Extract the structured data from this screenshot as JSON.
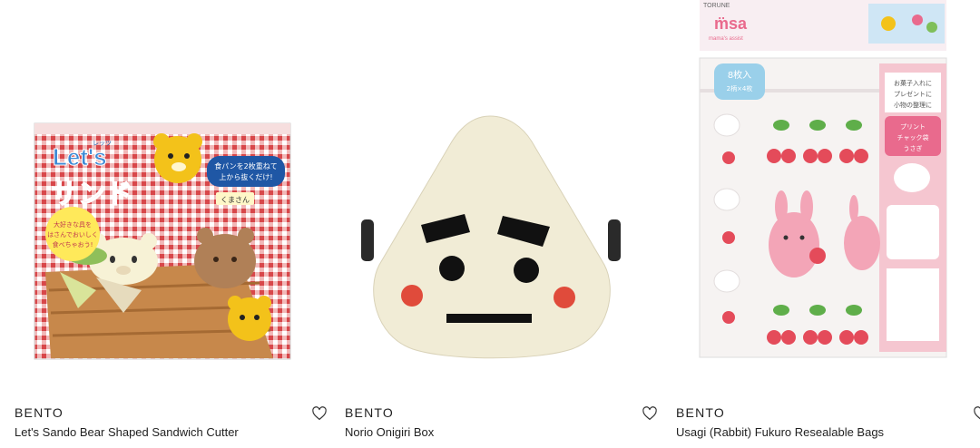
{
  "products": [
    {
      "brand": "BENTO",
      "title": "Let's Sando Bear Shaped Sandwich Cutter",
      "image_alt": "Let's Sando bear sandwich cutter box",
      "pkg_latin": "Let's",
      "pkg_katakana": "サンド",
      "pkg_ruby": "レッツ",
      "pkg_bubble_line1": "食パンを2枚重ねて",
      "pkg_bubble_line2": "上から抜くだけ!",
      "pkg_name": "くまさん",
      "pkg_promo_line1": "大好きな具を",
      "pkg_promo_line2": "はさんでおいしく",
      "pkg_promo_line3": "食べちゃおう!"
    },
    {
      "brand": "BENTO",
      "title": "Norio Onigiri Box",
      "image_alt": "Onigiri shaped lunch box with a face"
    },
    {
      "brand": "BENTO",
      "title": "Usagi (Rabbit) Fukuro Resealable Bags",
      "image_alt": "Pink rabbit and cherry resealable bags pack",
      "pkg_maker": "TORUNE",
      "pkg_logo": "m̈sa",
      "pkg_logo_sub": "mama's assist",
      "pkg_count": "8枚入",
      "pkg_count_sub": "2柄×4枚",
      "pkg_side_line1": "お菓子入れに",
      "pkg_side_line2": "プレゼントに",
      "pkg_side_line3": "小物の整理に",
      "pkg_label_line1": "プリント",
      "pkg_label_line2": "チャック袋",
      "pkg_label_line3": "うさぎ"
    }
  ],
  "colors": {
    "accent_pink": "#e96a8d",
    "box_red": "#d8474a",
    "onigiri_cream": "#f1ecd6",
    "cheek_red": "#e04b3b"
  }
}
